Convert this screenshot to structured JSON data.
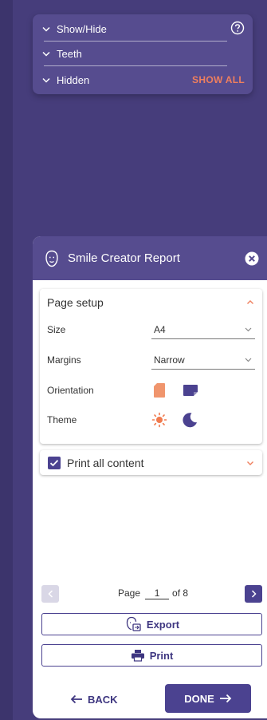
{
  "show_hide_panel": {
    "rows": [
      {
        "label": "Show/Hide"
      },
      {
        "label": "Teeth"
      },
      {
        "label": "Hidden"
      }
    ],
    "show_all_label": "SHOW ALL",
    "help_icon": "question-circle-icon"
  },
  "report": {
    "title": "Smile Creator Report",
    "close_icon": "close-circle-icon",
    "page_setup": {
      "title": "Page setup",
      "size_label": "Size",
      "size_value": "A4",
      "margins_label": "Margins",
      "margins_value": "Narrow",
      "orientation_label": "Orientation",
      "orientation_options": [
        "portrait-page-icon",
        "landscape-page-icon"
      ],
      "theme_label": "Theme",
      "theme_options": [
        "sun-icon",
        "moon-icon"
      ]
    },
    "print_all": {
      "label": "Print all content",
      "checked": true
    },
    "pager": {
      "page_label": "Page",
      "current": "1",
      "of_label": "of 8"
    },
    "export_label": "Export",
    "print_label": "Print",
    "back_label": "BACK",
    "done_label": "DONE"
  },
  "colors": {
    "background": "#463d7b",
    "panel": "#564c8f",
    "accent": "#4b4290",
    "show_all": "#ef7f5e",
    "orientation_orange": "#f0956d"
  }
}
